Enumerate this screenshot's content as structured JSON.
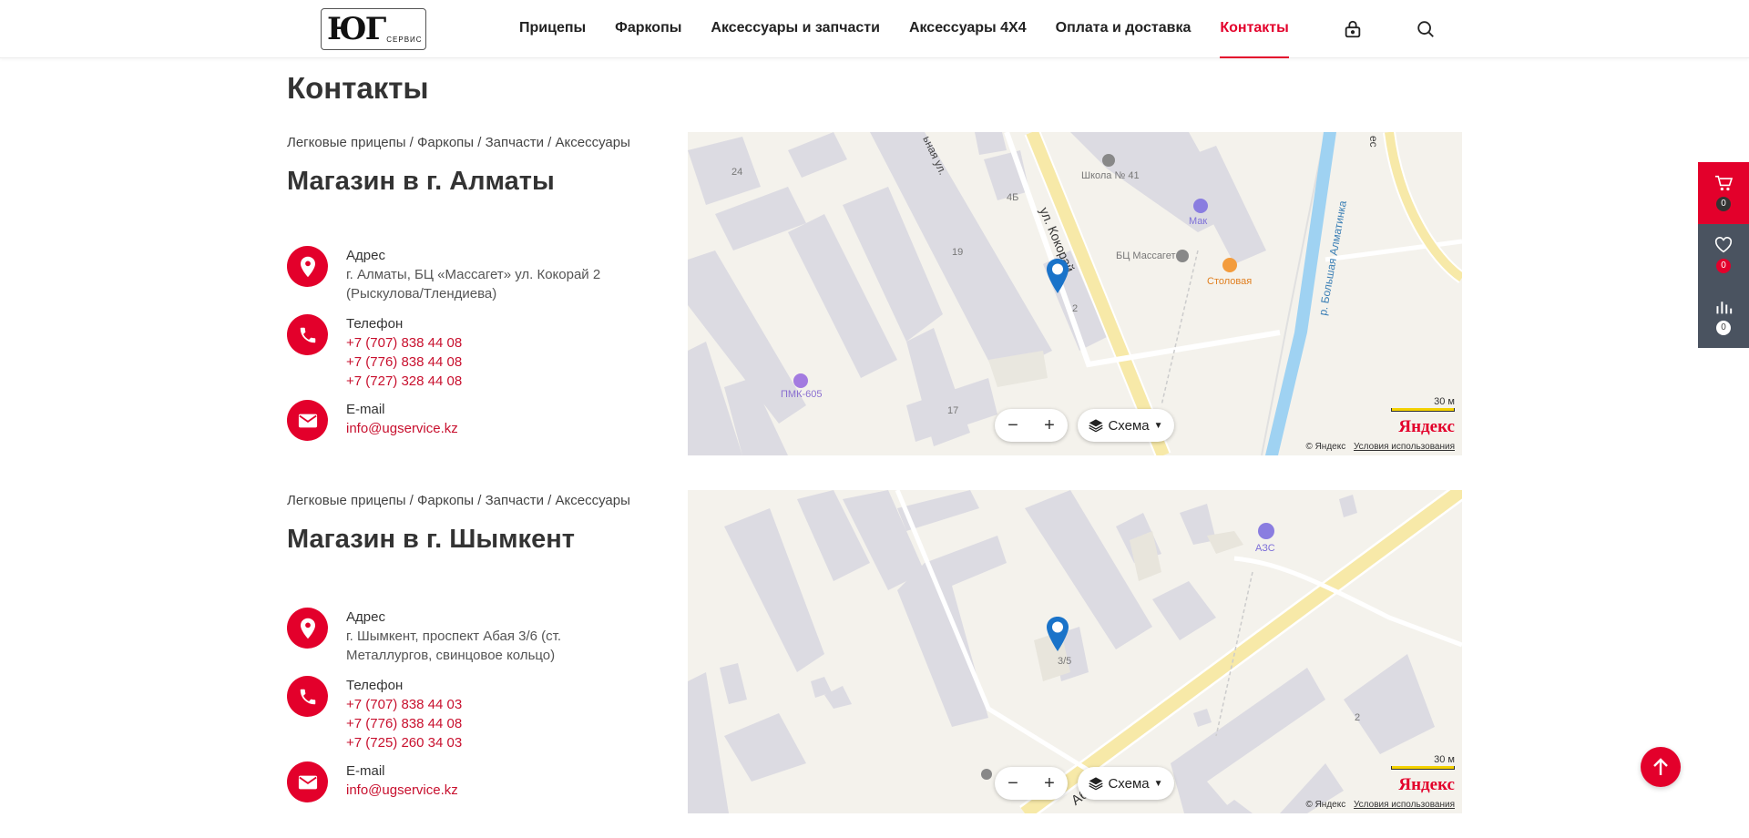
{
  "header": {
    "logo": "ЮГ",
    "logo_sub": "СЕРВИС",
    "nav": [
      {
        "label": "Прицепы"
      },
      {
        "label": "Фаркопы"
      },
      {
        "label": "Аксессуары и запчасти"
      },
      {
        "label": "Аксессуары 4Х4"
      },
      {
        "label": "Оплата и доставка"
      },
      {
        "label": "Контакты",
        "active": true
      }
    ],
    "icons": [
      "lock-icon",
      "search-icon"
    ]
  },
  "page": {
    "title": "Контакты"
  },
  "stores": [
    {
      "tags": "Легковые прицепы / Фаркопы / Запчасти / Аксессуары",
      "title": "Магазин в г. Алматы",
      "address_label": "Адрес",
      "address": "г. Алматы, БЦ «Массагет» ул. Кокорай 2 (Рыскулова/Тлендиева)",
      "phone_label": "Телефон",
      "phones": [
        "+7 (707) 838 44 08",
        "+7 (776) 838 44 08",
        "+7 (727) 328 44 08"
      ],
      "email_label": "E-mail",
      "email": "info@ugservice.kz",
      "map": {
        "labels": [
          "24",
          "4Б",
          "19",
          "17",
          "2",
          "Школа № 41",
          "Мак",
          "БЦ Массагет",
          "Столовая",
          "ПМК-605",
          "ул. Кокорай",
          "р. Большая Алматинка",
          "ьная ул.",
          "ес"
        ],
        "scale": "30 м",
        "layer": "Схема",
        "brand": "Яндекс",
        "copyright": "© Яндекс",
        "terms": "Условия использования"
      }
    },
    {
      "tags": "Легковые прицепы / Фаркопы / Запчасти / Аксессуары",
      "title": "Магазин в г. Шымкент",
      "address_label": "Адрес",
      "address": "г. Шымкент, проспект Абая 3/6 (ст. Металлургов, свинцовое кольцо)",
      "phone_label": "Телефон",
      "phones": [
        "+7 (707) 838 44 03",
        "+7 (776) 838 44 08",
        "+7 (725) 260 34 03"
      ],
      "email_label": "E-mail",
      "email": "info@ugservice.kz",
      "map": {
        "labels": [
          "АЗС",
          "3/5",
          "2",
          "Абая"
        ],
        "scale": "30 м",
        "layer": "Схема",
        "brand": "Яндекс",
        "copyright": "© Яндекс",
        "terms": "Условия использования"
      }
    }
  ],
  "side_panel": [
    {
      "icon": "cart-icon",
      "count": "0"
    },
    {
      "icon": "heart-icon",
      "count": "0"
    },
    {
      "icon": "compare-icon",
      "count": "0"
    }
  ],
  "colors": {
    "accent": "#e3002b",
    "side_dark": "#4a5360",
    "pin": "#1a73c9"
  }
}
